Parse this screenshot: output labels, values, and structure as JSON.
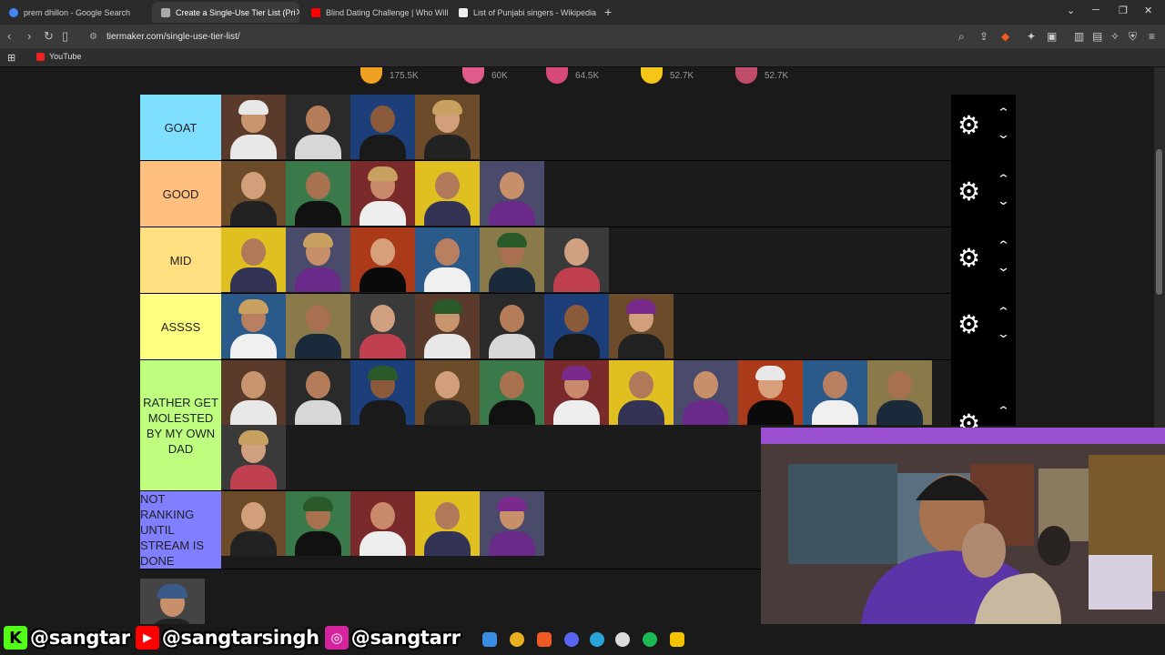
{
  "browser": {
    "tabs": [
      {
        "title": "prem dhillon - Google Search",
        "active": false,
        "color": "#4285f4"
      },
      {
        "title": "Create a Single-Use Tier List (Pri",
        "active": true,
        "color": "#aaaaaa"
      },
      {
        "title": "Blind Dating Challenge | Who Will Ki",
        "active": false,
        "color": "#ff0000"
      },
      {
        "title": "List of Punjabi singers - Wikipedia",
        "active": false,
        "color": "#eeeeee"
      }
    ],
    "url": "tiermaker.com/single-use-tier-list/",
    "bookmark": "YouTube"
  },
  "reactions": [
    {
      "emoji": "laugh",
      "count": "175.5K",
      "color": "#f0a020"
    },
    {
      "emoji": "love",
      "count": "60K",
      "color": "#e05a8a"
    },
    {
      "emoji": "wow",
      "count": "64.5K",
      "color": "#d84a7a"
    },
    {
      "emoji": "clap",
      "count": "52.7K",
      "color": "#f5c518"
    },
    {
      "emoji": "poop",
      "count": "52.7K",
      "color": "#c04d6a"
    }
  ],
  "tiers": [
    {
      "label": "GOAT",
      "color": "#7fdfff",
      "count": 4
    },
    {
      "label": "GOOD",
      "color": "#ffbf7f",
      "count": 5
    },
    {
      "label": "MID",
      "color": "#ffdf7f",
      "count": 6
    },
    {
      "label": "ASSSS",
      "color": "#ffff7f",
      "count": 7
    },
    {
      "label": "RATHER GET MOLESTED BY MY OWN DAD",
      "color": "#bfff7f",
      "count": 12
    },
    {
      "label": "NOT RANKING UNTIL STREAM IS DONE",
      "color": "#7f7fff",
      "count": 5
    }
  ],
  "unranked_count": 1,
  "overlay": {
    "kick": "@sangtar",
    "youtube": "@sangtarsingh",
    "instagram": "@sangtarr"
  }
}
